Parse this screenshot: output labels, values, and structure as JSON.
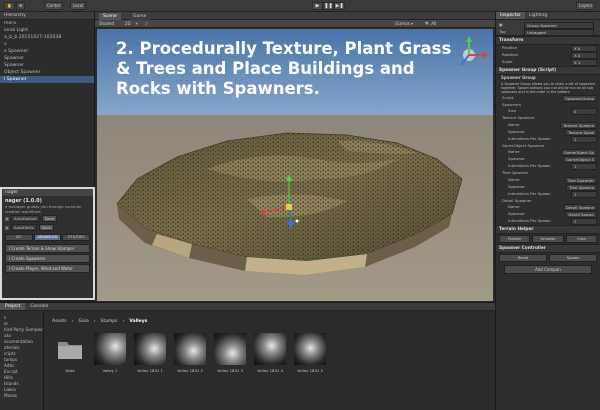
{
  "toolbar": {
    "tool_buttons": [
      "Center",
      "Local"
    ],
    "play_icons": [
      "▶",
      "❚❚",
      "▶❚"
    ],
    "layers_label": "Layers"
  },
  "hierarchy": {
    "tab_label": "Hierarchy",
    "items": [
      "mera",
      "ional Light",
      "a_b_b 20151027-102038",
      "x",
      "x Spawner",
      "Spawner",
      "Spawner",
      "Object Spawner",
      "l Spawner"
    ],
    "selected_index": 8
  },
  "manager": {
    "header": "nager",
    "title": "nager (1.0.0)",
    "description": "e manager guides you through common creation workflows.",
    "field1": "AutoDefault",
    "field2": "AutoFields",
    "small_btn": "Save",
    "tabs": [
      "SIC",
      "ADVANCED",
      "UTILITIES"
    ],
    "buttons": [
      "l Create Terrain & Show Stamper",
      "l Create Spawners",
      "l Create Player, Wind and Water"
    ]
  },
  "scene": {
    "tabs": [
      "Scene",
      "Game"
    ],
    "shading": "Shaded",
    "gizmos": "Gizmos ▾",
    "overlay_title": "2. Procedurally Texture, Plant Grass & Trees and Place Buildings and Rocks with Spawners.",
    "colors": {
      "sky_top": "#4a73a8",
      "sky_horizon": "#b6cfe3",
      "ground": "#9a9281",
      "terrain_dark": "#3b4227",
      "terrain_light": "#bba984"
    }
  },
  "inspector": {
    "tabs": [
      "Inspector",
      "Lighting"
    ],
    "object_name": "Group Spawner",
    "tag_label": "Tag",
    "tag_value": "Untagged",
    "transform_title": "Transform",
    "transform_rows": [
      {
        "label": "Position",
        "value": "X 0"
      },
      {
        "label": "Rotation",
        "value": "X 0"
      },
      {
        "label": "Scale",
        "value": "X 1"
      }
    ],
    "component_title": "Spawner Group (Script)",
    "component_sub": "Spawner Group",
    "component_desc": "A Spawner Group allows you to chain a set of spawners together. Spawn buttons you run will be run on all sub spawners and in the order in the pattern",
    "rows": [
      {
        "label": "Script",
        "value": "SpawnerGroup",
        "indent": false
      },
      {
        "label": "Spawners",
        "value": "",
        "indent": false
      },
      {
        "label": "Size",
        "value": "4",
        "indent": true
      },
      {
        "label": "Texture Spawner",
        "value": "",
        "indent": false
      },
      {
        "label": "Name",
        "value": "Texture Spawne",
        "indent": true
      },
      {
        "label": "Spawner",
        "value": "Texture Spaw",
        "indent": true
      },
      {
        "label": "Interations Per Spawn",
        "value": "1",
        "indent": true
      },
      {
        "label": "GameObject Spawner",
        "value": "",
        "indent": false
      },
      {
        "label": "Name",
        "value": "GameObject Sp",
        "indent": true
      },
      {
        "label": "Spawner",
        "value": "GameObject S",
        "indent": true
      },
      {
        "label": "Interations Per Spawn",
        "value": "1",
        "indent": true
      },
      {
        "label": "Tree Spawner",
        "value": "",
        "indent": false
      },
      {
        "label": "Name",
        "value": "Tree Spawner",
        "indent": true
      },
      {
        "label": "Spawner",
        "value": "Tree Spawne",
        "indent": true
      },
      {
        "label": "Interations Per Spawn",
        "value": "1",
        "indent": true
      },
      {
        "label": "Detail Spawner",
        "value": "",
        "indent": false
      },
      {
        "label": "Name",
        "value": "Detail Spawne",
        "indent": true
      },
      {
        "label": "Spawner",
        "value": "Detail Spawn",
        "indent": true
      },
      {
        "label": "Interations Per Spawn",
        "value": "1",
        "indent": true
      }
    ],
    "helper_title": "Terrain Helper",
    "helper_buttons": [
      "Flatten",
      "Smooth",
      "Clea"
    ],
    "controller_title": "Spawner Controller",
    "controller_buttons": [
      "Reset",
      "Spawn"
    ],
    "add_component": "Add Compon"
  },
  "project": {
    "tabs": [
      "Project",
      "Console"
    ],
    "tree_items": [
      "s",
      "ie",
      "hird Party Samplers",
      "ata",
      "ocumentation",
      "aterials",
      "cripts",
      "tamps",
      "Adtic",
      "Encrpt",
      "Hills",
      "Islands",
      "Lakes",
      "Mesas"
    ],
    "breadcrumb": [
      "Assets",
      "Gaia",
      "Stamps",
      "Valleys"
    ],
    "assets": [
      {
        "label": "Data",
        "type": "folder"
      },
      {
        "label": "Valley 1",
        "type": "stamp"
      },
      {
        "label": "Valley 1831 1",
        "type": "stamp"
      },
      {
        "label": "Valley 1831 2",
        "type": "stamp"
      },
      {
        "label": "Valley 1831 3",
        "type": "stamp"
      },
      {
        "label": "Valley 1831 4",
        "type": "stamp"
      },
      {
        "label": "Valley 1831 5",
        "type": "stamp"
      }
    ]
  }
}
